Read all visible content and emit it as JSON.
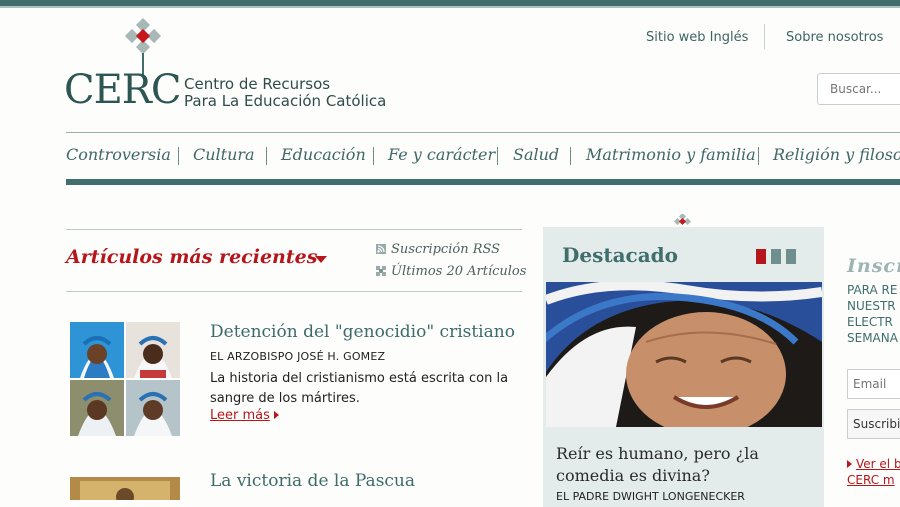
{
  "header": {
    "logo_word": "CERC",
    "logo_line1": "Centro de Recursos",
    "logo_line2": "Para La Educación Católica",
    "links": [
      "Sitio web Inglés",
      "Sobre nosotros"
    ],
    "search_placeholder": "Buscar..."
  },
  "nav": {
    "items": [
      "Controversia",
      "Cultura",
      "Educación",
      "Fe y carácter",
      "Salud",
      "Matrimonio y familia",
      "Religión y filosofía"
    ]
  },
  "colors": {
    "brand_teal": "#3f6e6c",
    "accent_red": "#b5161b",
    "panel_bg": "#e3ecea"
  },
  "recent": {
    "title": "Artículos más recientes",
    "rss_label": "Suscripción RSS",
    "last20_label": "Últimos 20 Artículos",
    "rss_icon": "rss-icon",
    "list_icon": "grid-icon",
    "articles": [
      {
        "title": "Detención del \"genocidio\" cristiano",
        "author": "EL ARZOBISPO JOSÉ H. GOMEZ",
        "summary": "La historia del cristianismo está escrita con la sangre de los mártires.",
        "more": "Leer más"
      },
      {
        "title": "La victoria de la Pascua"
      }
    ]
  },
  "featured": {
    "title": "Destacado",
    "headline": "Reír es humano, pero ¿la comedia es divina?",
    "author": "EL PADRE DWIGHT LONGENECKER"
  },
  "subscribe": {
    "title": "Inscr",
    "lines": [
      "PARA RE",
      "NUESTR",
      "ELECTR",
      "SEMANA"
    ],
    "email_placeholder": "Email",
    "button": "Suscribi",
    "link_line1": "Ver el b",
    "link_line2": "CERC m"
  }
}
